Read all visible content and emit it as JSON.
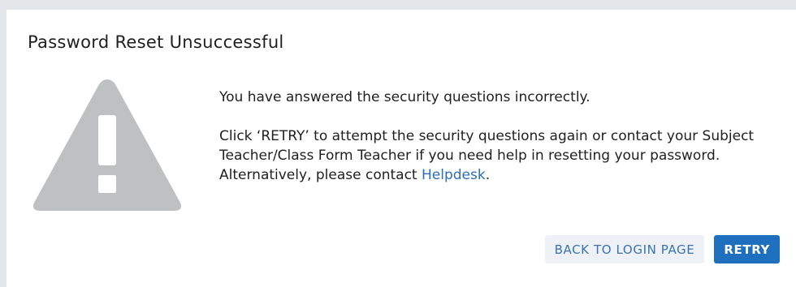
{
  "dialog": {
    "title": "Password Reset Unsuccessful",
    "icon": "warning-triangle-icon",
    "message_primary": "You have answered the security questions incorrectly.",
    "message_secondary": "Click ‘RETRY’ to attempt the security questions again or contact your Subject Teacher/Class Form Teacher if you need help in resetting your password.",
    "alt_prefix": "Alternatively, please contact ",
    "alt_link": "Helpdesk",
    "alt_suffix": ".",
    "buttons": {
      "back_label": "BACK TO LOGIN PAGE",
      "retry_label": "RETRY"
    }
  },
  "colors": {
    "background": "#e5e6ea",
    "icon": "#bfc0c2",
    "link": "#2b6fb8",
    "primary_button": "#1f6fbf",
    "secondary_button": "#eef1f5"
  }
}
